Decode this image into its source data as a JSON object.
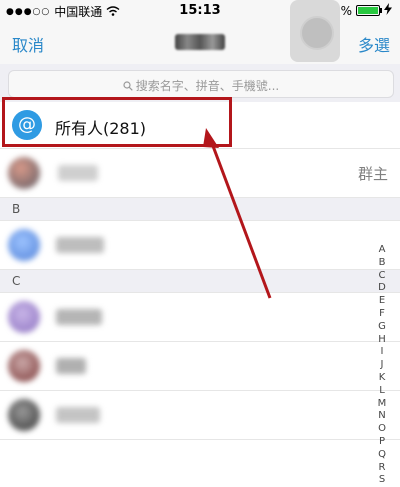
{
  "status": {
    "carrier": "中国联通",
    "signal_dots": "●●●○○",
    "time": "15:13",
    "battery": "100%",
    "battery_level": 1.0
  },
  "nav": {
    "cancel": "取消",
    "multi_select": "多選"
  },
  "search": {
    "placeholder": "搜索名字、拼音、手機號..."
  },
  "everyone": {
    "icon": "@",
    "label": "所有人(281)"
  },
  "owner_role": "群主",
  "sections": [
    "B",
    "C"
  ],
  "index_letters": [
    "A",
    "B",
    "C",
    "D",
    "E",
    "F",
    "G",
    "H",
    "I",
    "J",
    "K",
    "L",
    "M",
    "N",
    "O",
    "P",
    "Q",
    "R",
    "S"
  ],
  "colors": {
    "accent": "#2a88c9",
    "highlight": "#b3161b",
    "at_icon": "#2f9be3"
  }
}
